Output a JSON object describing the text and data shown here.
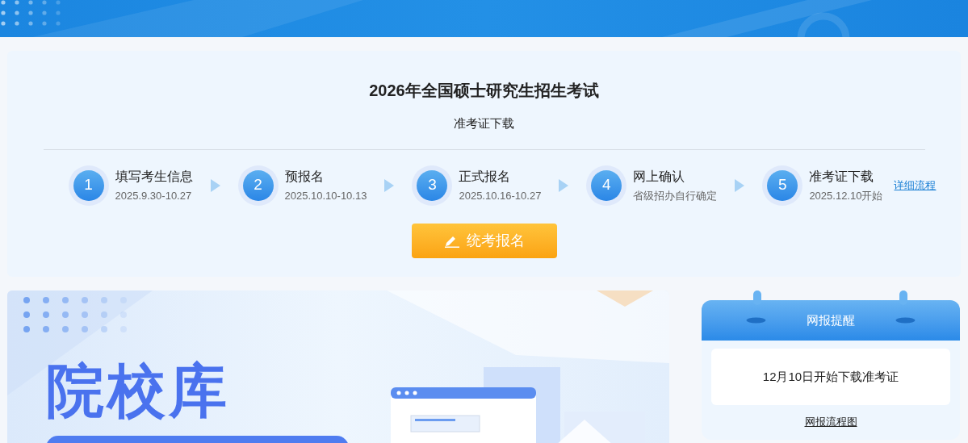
{
  "exam": {
    "title": "2026年全国硕士研究生招生考试",
    "subtitle": "准考证下载"
  },
  "steps": [
    {
      "number": "1",
      "name": "填写考生信息",
      "date": "2025.9.30-10.27"
    },
    {
      "number": "2",
      "name": "预报名",
      "date": "2025.10.10-10.13"
    },
    {
      "number": "3",
      "name": "正式报名",
      "date": "2025.10.16-10.27"
    },
    {
      "number": "4",
      "name": "网上确认",
      "date": "省级招办自行确定"
    },
    {
      "number": "5",
      "name": "准考证下载",
      "date": "2025.12.10开始"
    }
  ],
  "detail_link": "详细流程",
  "register_button": "统考报名",
  "banner": {
    "title": "院校库"
  },
  "reminder": {
    "title": "网报提醒",
    "message": "12月10日开始下载准考证",
    "link": "网报流程图"
  }
}
